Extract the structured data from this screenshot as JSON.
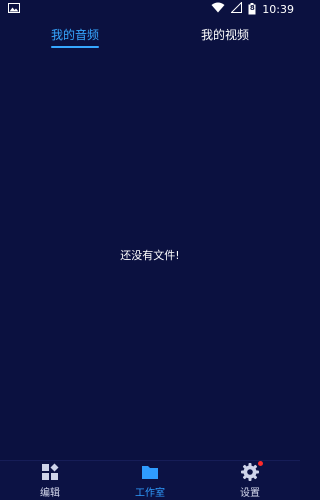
{
  "status_bar": {
    "time": "10:39",
    "battery_level": "8"
  },
  "tabs": [
    {
      "label": "我的音频",
      "active": true
    },
    {
      "label": "我的视频",
      "active": false
    }
  ],
  "content": {
    "empty_message": "还没有文件!"
  },
  "bottom_nav": [
    {
      "label": "编辑",
      "icon": "grid-edit-icon",
      "active": false
    },
    {
      "label": "工作室",
      "icon": "folder-icon",
      "active": true
    },
    {
      "label": "设置",
      "icon": "gear-icon",
      "active": false,
      "badge": true
    }
  ],
  "colors": {
    "background": "#0b1140",
    "accent": "#36a7ff",
    "badge": "#ff2a2a"
  }
}
